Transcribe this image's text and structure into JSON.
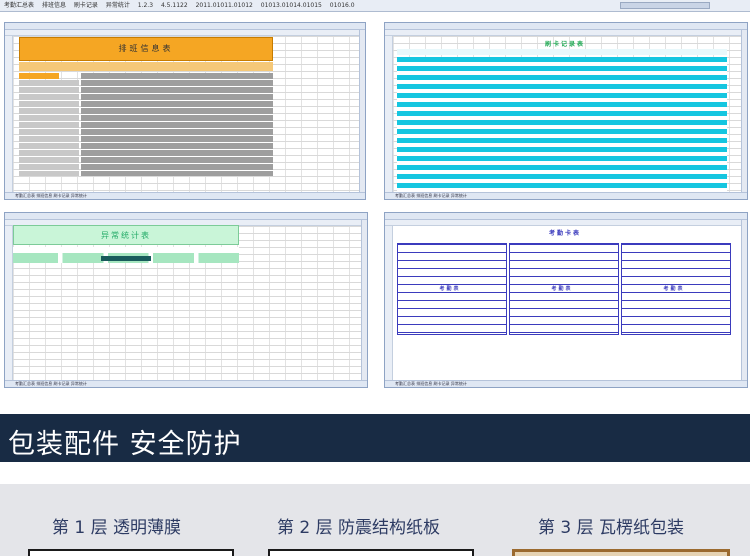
{
  "top_tabs": [
    "考勤汇总表",
    "排班信息",
    "刷卡记录",
    "异常统计",
    "1.2.3",
    "4.5.1122",
    "2011.01011.01012",
    "01013.01014.01015",
    "01016.0"
  ],
  "sheet1": {
    "title": "排班信息表",
    "tabs": "考勤汇总表 排班信息 刷卡记录 异常统计"
  },
  "sheet2": {
    "title": "刷卡记录表",
    "tabs": "考勤汇总表 排班信息 刷卡记录 异常统计"
  },
  "sheet3": {
    "title": "异常统计表",
    "tabs": "考勤汇总表 排班信息 刷卡记录 异常统计"
  },
  "sheet4": {
    "title": "考勤卡表",
    "section": "考勤表",
    "tabs": "考勤汇总表 排班信息 刷卡记录 异常统计"
  },
  "banner": {
    "text": "包装配件 安全防护"
  },
  "layers": [
    {
      "label": "第 1 层  透明薄膜"
    },
    {
      "label": "第 2 层  防震结构纸板"
    },
    {
      "label": "第 3 层  瓦楞纸包装"
    }
  ],
  "colors": {
    "banner_bg": "#182b44",
    "accent_orange": "#f5a623",
    "accent_cyan": "#15c6e0",
    "accent_green": "#c9f5d8"
  }
}
